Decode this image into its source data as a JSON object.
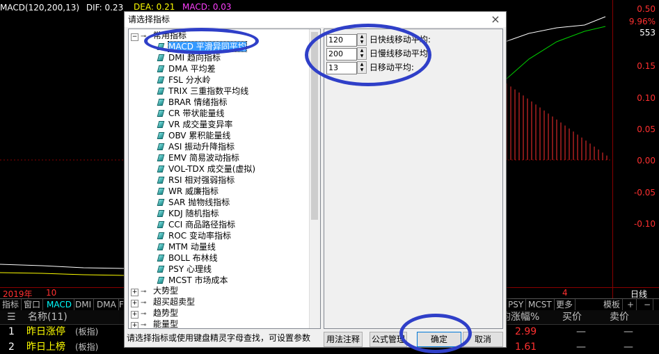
{
  "macd_header": {
    "name": "MACD(120,200,13)",
    "dif": "DIF: 0.23",
    "dea": "DEA: 0.21",
    "macd": "MACD: 0.03"
  },
  "y_axis": [
    "0.50",
    "9.96%",
    "553",
    "0.15",
    "0.10",
    "0.05",
    "0.00",
    "-0.05",
    "-0.10"
  ],
  "bottom_axis": {
    "year": "2019年",
    "month": "10",
    "right_month": "4",
    "period": "日线"
  },
  "tabs": [
    "指标",
    "窗口",
    "MACD",
    "DMI",
    "DMA",
    "F"
  ],
  "tabs_right": [
    "PSY",
    "MCST",
    "更多",
    "模板",
    "+",
    "−"
  ],
  "list_header": {
    "menu": "☰",
    "name": "名称(11)",
    "change": "均涨幅%",
    "buy": "买价",
    "sell": "卖价"
  },
  "rows": [
    {
      "idx": "1",
      "name": "昨日涨停",
      "tag": "(板指)",
      "change": "2.99",
      "buy": "—",
      "sell": "—"
    },
    {
      "idx": "2",
      "name": "昨日上榜",
      "tag": "(板指)",
      "change": "1.61",
      "buy": "—",
      "sell": "—"
    }
  ],
  "dialog": {
    "title": "请选择指标",
    "close": "×",
    "tree_root": "常用指标",
    "indicators": [
      "MACD 平滑异同平均",
      "DMI 趋向指标",
      "DMA 平均差",
      "FSL 分水岭",
      "TRIX 三重指数平均线",
      "BRAR 情绪指标",
      "CR 带状能量线",
      "VR 成交量变异率",
      "OBV 累积能量线",
      "ASI 振动升降指标",
      "EMV 简易波动指标",
      "VOL-TDX 成交量(虚拟)",
      "RSI 相对强弱指标",
      "WR 威廉指标",
      "SAR 抛物线指标",
      "KDJ 随机指标",
      "CCI 商品路径指标",
      "ROC 变动率指标",
      "MTM 动量线",
      "BOLL 布林线",
      "PSY 心理线",
      "MCST 市场成本"
    ],
    "groups": [
      "大势型",
      "超买超卖型",
      "趋势型",
      "能量型"
    ],
    "params": [
      {
        "value": "120",
        "label": "日快线移动平均:"
      },
      {
        "value": "200",
        "label": "日慢线移动平均:"
      },
      {
        "value": "13",
        "label": "日移动平均:"
      }
    ],
    "status": "请选择指标或使用键盘精灵字母查找，可设置参数",
    "btn_usage": "用法注释",
    "btn_manage": "公式管理",
    "btn_ok": "确定",
    "btn_cancel": "取消"
  },
  "colors": {
    "annotation": "#2f3fc8",
    "selection": "#3399ff",
    "up": "#ff3030"
  }
}
